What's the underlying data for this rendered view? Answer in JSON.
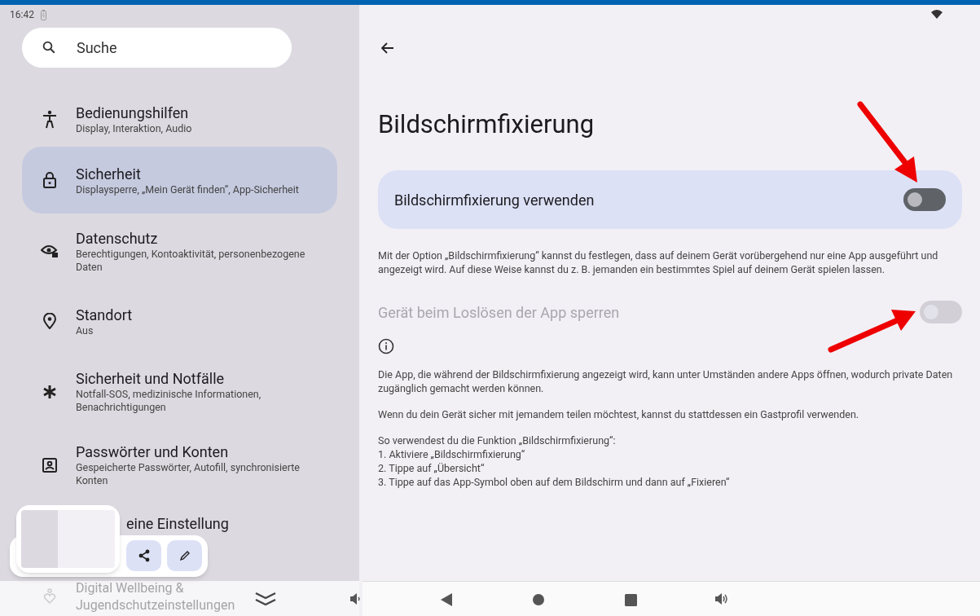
{
  "status_bar": {
    "time": "16:42"
  },
  "search": {
    "placeholder": "Suche"
  },
  "sidebar": {
    "items": [
      {
        "title": "Bedienungshilfen",
        "subtitle": "Display, Interaktion, Audio",
        "selected": false
      },
      {
        "title": "Sicherheit",
        "subtitle": "Displaysperre, „Mein Gerät finden“, App-Sicherheit",
        "selected": true
      },
      {
        "title": "Datenschutz",
        "subtitle": "Berechtigungen, Kontoaktivität, personenbezogene Daten",
        "selected": false
      },
      {
        "title": "Standort",
        "subtitle": "Aus",
        "selected": false
      },
      {
        "title": "Sicherheit und Notfälle",
        "subtitle": "Notfall-SOS, medizinische Informationen, Benachrichtigungen",
        "selected": false
      },
      {
        "title": "Passwörter und Konten",
        "subtitle": "Gespeicherte Passwörter, Autofill, synchronisierte Konten",
        "selected": false
      },
      {
        "title": "eine Einstellung",
        "selected": false
      },
      {
        "title": "Digital Wellbeing & Jugendschutzeinstellungen",
        "selected": false
      }
    ]
  },
  "page": {
    "title": "Bildschirmfixierung",
    "main_toggle": {
      "label": "Bildschirmfixierung verwenden",
      "on": false,
      "disabled": false
    },
    "description": "Mit der Option „Bildschirmfixierung“ kannst du festlegen, dass auf deinem Gerät vorübergehend nur eine App ausgeführt und angezeigt wird. Auf diese Weise kannst du z. B. jemanden ein bestimmtes Spiel auf deinem Gerät spielen lassen.",
    "lock_toggle": {
      "label": "Gerät beim Loslösen der App sperren",
      "on": false,
      "disabled": true
    },
    "info_paragraphs": [
      "Die App, die während der Bildschirmfixierung angezeigt wird, kann unter Umständen andere Apps öffnen, wodurch private Daten zugänglich gemacht werden können.",
      "Wenn du dein Gerät sicher mit jemandem teilen möchtest, kannst du stattdessen ein Gastprofil verwenden.",
      "So verwendest du die Funktion „Bildschirmfixierung“:\n1. Aktiviere „Bildschirmfixierung“\n2. Tippe auf „Übersicht“\n3. Tippe auf das App-Symbol oben auf dem Bildschirm und dann auf „Fixieren“"
    ]
  }
}
